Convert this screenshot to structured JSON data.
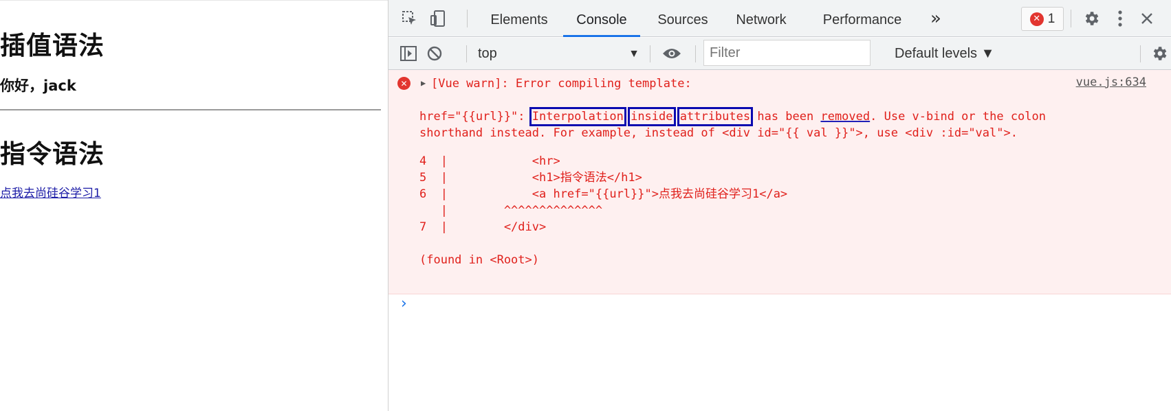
{
  "page": {
    "heading1": "插值语法",
    "greeting": "你好，jack",
    "heading2": "指令语法",
    "link_text": "点我去尚硅谷学习1"
  },
  "devtools": {
    "tabs": [
      "Elements",
      "Console",
      "Sources",
      "Network",
      "Performance"
    ],
    "active_tab": "Console",
    "more_tabs": "»",
    "error_count": "1",
    "toolbar": {
      "context": "top",
      "filter_placeholder": "Filter",
      "levels": "Default levels ▼"
    },
    "console": {
      "warn_title": "[Vue warn]: Error compiling template:",
      "source_link": "vue.js:634",
      "line1_prefix": "href=\"{{url}}\": ",
      "w_interpolation": "Interpolation",
      "w_inside": "inside",
      "w_attributes": "attributes",
      "w_has_been": " has been ",
      "w_removed": "removed",
      "line1_suffix": ". Use v-bind or the colon",
      "line2": "shorthand instead. For example, instead of <div id=\"{{ val }}\">, use <div :id=\"val\">.",
      "code_lines": [
        "4  |            <hr>",
        "5  |            <h1>指令语法</h1>",
        "6  |            <a href=\"{{url}}\">点我去尚硅谷学习1</a>",
        "   |        ^^^^^^^^^^^^^^",
        "7  |        </div>"
      ],
      "found_in": "(found in <Root>)"
    }
  },
  "colors": {
    "error_red": "#e0201b",
    "error_bg": "#fef0f0",
    "annotation_blue": "#0a0ab0",
    "tab_accent": "#1a73e8"
  }
}
